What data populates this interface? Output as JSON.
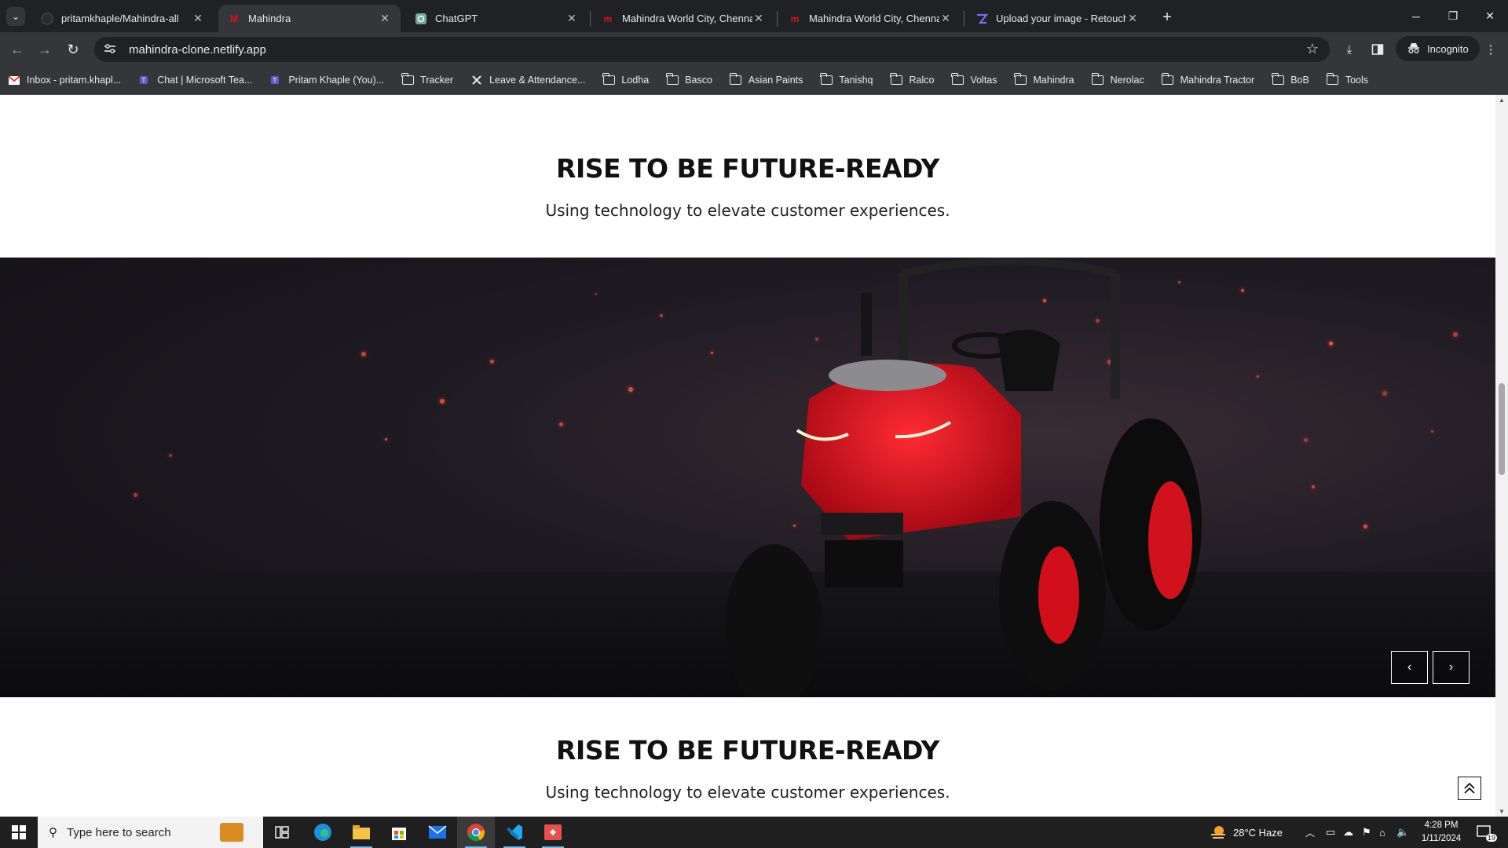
{
  "browser": {
    "tabs": [
      {
        "title": "pritamkhaple/Mahindra-all",
        "favicon": "github-icon",
        "active": false
      },
      {
        "title": "Mahindra",
        "favicon": "mahindra-logo-icon",
        "active": true
      },
      {
        "title": "ChatGPT",
        "favicon": "chatgpt-icon",
        "active": false
      },
      {
        "title": "Mahindra World City, Chennai s",
        "favicon": "mahindra-world-city-icon",
        "active": false
      },
      {
        "title": "Mahindra World City, Chennai s",
        "favicon": "mahindra-world-city-icon",
        "active": false
      },
      {
        "title": "Upload your image - Retoucher",
        "favicon": "retoucher-icon",
        "active": false
      }
    ],
    "url": "mahindra-clone.netlify.app",
    "incognito_label": "Incognito",
    "bookmarks": [
      {
        "label": "Inbox - pritam.khapl...",
        "icon": "gmail-icon"
      },
      {
        "label": "Chat | Microsoft Tea...",
        "icon": "teams-icon"
      },
      {
        "label": "Pritam Khaple (You)...",
        "icon": "teams-icon"
      },
      {
        "label": "Tracker",
        "icon": "folder-icon"
      },
      {
        "label": "Leave & Attendance...",
        "icon": "x-logo-icon"
      },
      {
        "label": "Lodha",
        "icon": "folder-icon"
      },
      {
        "label": "Basco",
        "icon": "folder-icon"
      },
      {
        "label": "Asian Paints",
        "icon": "folder-icon"
      },
      {
        "label": "Tanishq",
        "icon": "folder-icon"
      },
      {
        "label": "Ralco",
        "icon": "folder-icon"
      },
      {
        "label": "Voltas",
        "icon": "folder-icon"
      },
      {
        "label": "Mahindra",
        "icon": "folder-icon"
      },
      {
        "label": "Nerolac",
        "icon": "folder-icon"
      },
      {
        "label": "Mahindra Tractor",
        "icon": "folder-icon"
      },
      {
        "label": "BoB",
        "icon": "folder-icon"
      },
      {
        "label": "Tools",
        "icon": "folder-icon"
      }
    ]
  },
  "page": {
    "section1": {
      "heading": "RISE TO BE FUTURE-READY",
      "subheading": "Using technology to elevate customer experiences."
    },
    "carousel": {
      "prev_label": "‹",
      "next_label": "›",
      "image": "red-compact-tractor"
    },
    "section2": {
      "heading": "RISE TO BE FUTURE-READY",
      "subheading": "Using technology to elevate customer experiences."
    }
  },
  "taskbar": {
    "search_placeholder": "Type here to search",
    "weather": "28°C  Haze",
    "time": "4:28 PM",
    "date": "1/11/2024",
    "notification_count": "19"
  },
  "colors": {
    "accent_red": "#e0141e",
    "page_bg": "#ffffff",
    "chrome_dark": "#202124"
  }
}
